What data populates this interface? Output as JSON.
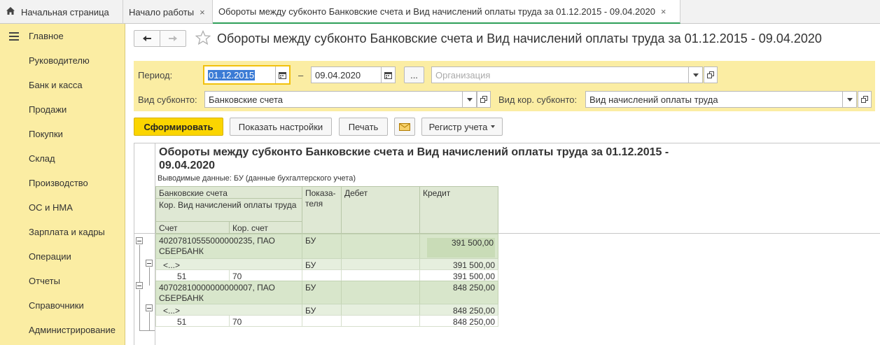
{
  "tabs": [
    {
      "label": "Начальная страница"
    },
    {
      "label": "Начало работы",
      "close": "×"
    },
    {
      "label": "Обороты между субконто Банковские счета и Вид начислений оплаты труда за 01.12.2015 - 09.04.2020",
      "close": "×"
    }
  ],
  "sidebar": {
    "items": [
      {
        "label": "Главное"
      },
      {
        "label": "Руководителю"
      },
      {
        "label": "Банк и касса"
      },
      {
        "label": "Продажи"
      },
      {
        "label": "Покупки"
      },
      {
        "label": "Склад"
      },
      {
        "label": "Производство"
      },
      {
        "label": "ОС и НМА"
      },
      {
        "label": "Зарплата и кадры"
      },
      {
        "label": "Операции"
      },
      {
        "label": "Отчеты"
      },
      {
        "label": "Справочники"
      },
      {
        "label": "Администрирование"
      }
    ]
  },
  "page": {
    "title": "Обороты между субконто Банковские счета и Вид начислений оплаты труда за 01.12.2015 - 09.04.2020"
  },
  "filter": {
    "period_label": "Период:",
    "date_from": "01.12.2015",
    "dash": "–",
    "date_to": "09.04.2020",
    "ellipsis": "...",
    "org_placeholder": "Организация",
    "subkonto_label": "Вид субконто:",
    "subkonto_value": "Банковские счета",
    "kor_subkonto_label": "Вид кор. субконто:",
    "kor_subkonto_value": "Вид начислений оплаты труда"
  },
  "toolbar": {
    "generate": "Сформировать",
    "show_settings": "Показать настройки",
    "print": "Печать",
    "register": "Регистр учета"
  },
  "report": {
    "title_line1": "Обороты между субконто Банковские счета и Вид начислений оплаты труда за 01.12.2015 -",
    "title_line2": "09.04.2020",
    "subtitle": "Выводимые данные:   БУ (данные бухгалтерского учета)",
    "headers": {
      "bank_accounts": "Банковские счета",
      "kor_vid": "Кор. Вид начислений оплаты труда",
      "schet": "Счет",
      "kor_schet": "Кор. счет",
      "pokazateli": "Показа-теля",
      "debet": "Дебет",
      "kredit": "Кредит"
    },
    "groups": [
      {
        "name_line1": "40207810555000000235, ПАО",
        "name_line2": "СБЕРБАНК",
        "indicator": "БУ",
        "credit": "391 500,00",
        "sub": {
          "name": "<...>",
          "indicator": "БУ",
          "credit": "391 500,00"
        },
        "detail": {
          "schet": "51",
          "kor_schet": "70",
          "credit": "391 500,00"
        }
      },
      {
        "name_line1": "40702810000000000007, ПАО",
        "name_line2": "СБЕРБАНК",
        "indicator": "БУ",
        "credit": "848 250,00",
        "sub": {
          "name": "<...>",
          "indicator": "БУ",
          "credit": "848 250,00"
        },
        "detail": {
          "schet": "51",
          "kor_schet": "70",
          "credit": "848 250,00"
        }
      }
    ]
  }
}
